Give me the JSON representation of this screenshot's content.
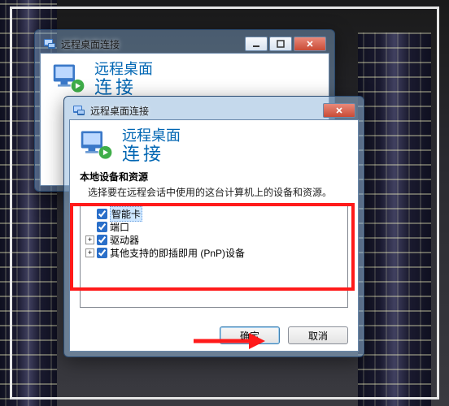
{
  "window_back": {
    "title": "远程桌面连接",
    "heading": "远程桌面",
    "subheading": "连接"
  },
  "dialog": {
    "title": "远程桌面连接",
    "heading": "远程桌面",
    "subheading": "连接",
    "section_label": "本地设备和资源",
    "section_desc": "选择要在远程会话中使用的这台计算机上的设备和资源。",
    "tree": {
      "item_smartcard": "智能卡",
      "item_ports": "端口",
      "item_drives": "驱动器",
      "item_pnp": "其他支持的即插即用 (PnP)设备"
    },
    "buttons": {
      "ok": "确定",
      "cancel": "取消"
    }
  }
}
